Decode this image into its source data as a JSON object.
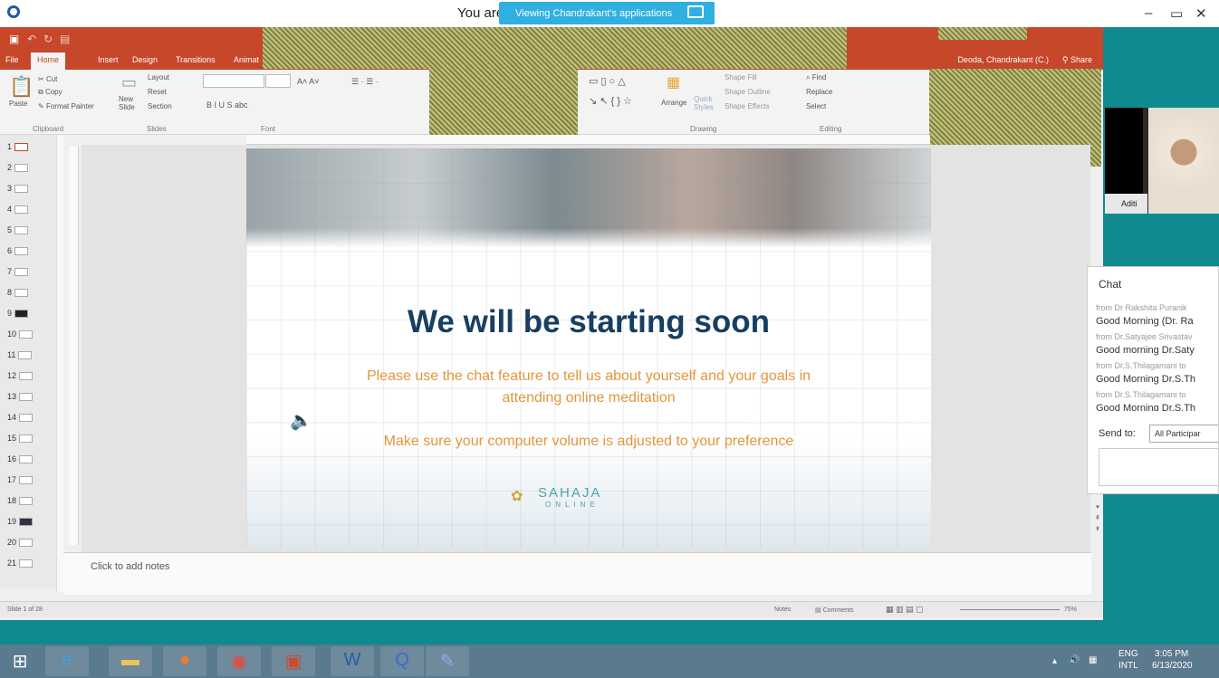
{
  "screen_share": {
    "prefix_text": "You are",
    "banner_text": "Viewing Chandrakant's applications",
    "window_controls": {
      "minimize": "–",
      "restore": "▭",
      "close": "✕"
    }
  },
  "ppt": {
    "ribbon_tabs": [
      {
        "label": "File",
        "active": false
      },
      {
        "label": "Home",
        "active": true
      },
      {
        "label": "Insert",
        "active": false
      },
      {
        "label": "Design",
        "active": false
      },
      {
        "label": "Transitions",
        "active": false
      },
      {
        "label": "Animat",
        "active": false
      }
    ],
    "user_name": "Deoda, Chandrakant (C.)",
    "share_label": "Share",
    "clipboard": {
      "paste": "Paste",
      "cut": "Cut",
      "copy": "Copy",
      "format_painter": "Format Painter",
      "group": "Clipboard"
    },
    "slides_group": {
      "new_slide": "New Slide",
      "layout": "Layout",
      "reset": "Reset",
      "section": "Section",
      "group": "Slides"
    },
    "font_group": {
      "group": "Font"
    },
    "drawing": {
      "arrange": "Arrange",
      "quick_styles": "Quick Styles",
      "shape_fill": "Shape Fill",
      "shape_outline": "Shape Outline",
      "shape_effects": "Shape Effects",
      "group": "Drawing"
    },
    "editing": {
      "find": "Find",
      "replace": "Replace",
      "select": "Select",
      "group": "Editing"
    },
    "slide_numbers": [
      "1",
      "2",
      "3",
      "4",
      "5",
      "6",
      "7",
      "8",
      "9",
      "10",
      "11",
      "12",
      "13",
      "14",
      "15",
      "16",
      "17",
      "18",
      "19",
      "20",
      "21"
    ],
    "slide": {
      "headline": "We will be starting soon",
      "line1": "Please use the chat feature to tell us about yourself and your goals in attending online meditation",
      "line2": "Make sure your computer volume is adjusted to your preference",
      "logo_main": "SAHAJA",
      "logo_sub": "ONLINE"
    },
    "notes_placeholder": "Click to add notes",
    "status": {
      "slide_counter": "Slide 1 of 28",
      "notes": "Notes",
      "comments": "Comments",
      "zoom": "75%"
    }
  },
  "video": {
    "participant_label": "Aditi"
  },
  "chat": {
    "title": "Chat",
    "messages": [
      {
        "from": "from Dr Rakshita Puranik",
        "text": "Good Morning (Dr. Ra"
      },
      {
        "from": "from Dr.Satyajee Srivastav",
        "text": "Good morning Dr.Saty"
      },
      {
        "from": "from Dr.S.Thilagamani to",
        "text": "Good Morning Dr.S.Th"
      },
      {
        "from": "from Dr.S.Thilagamani to",
        "text": "Good Morning Dr.S.Th"
      }
    ],
    "send_to_label": "Send to:",
    "send_to_value": "All Participar"
  },
  "taskbar": {
    "language": "ENG",
    "layout": "INTL",
    "time": "3:05 PM",
    "date": "6/13/2020"
  }
}
